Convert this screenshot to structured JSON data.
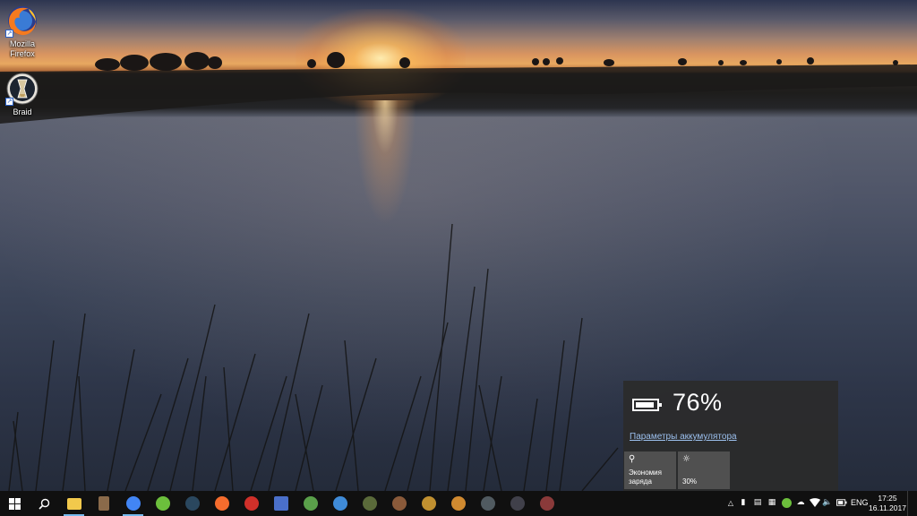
{
  "desktop": {
    "icons": [
      {
        "label_line1": "Mozilla",
        "label_line2": "Firefox",
        "icon": "firefox-icon"
      },
      {
        "label_line1": "Braid",
        "label_line2": "",
        "icon": "braid-icon"
      }
    ]
  },
  "battery_flyout": {
    "percent": "76%",
    "charge_level": 0.76,
    "settings_link": "Параметры аккумулятора",
    "tiles": [
      {
        "icon": "leaf-icon",
        "label_line1": "Экономия",
        "label_line2": "заряда"
      },
      {
        "icon": "brightness-icon",
        "label_line1": "30%",
        "label_line2": ""
      }
    ]
  },
  "taskbar": {
    "start_icon": "windows-logo-icon",
    "search_icon": "search-icon",
    "apps": [
      {
        "name": "file-explorer",
        "color": "#f2c94c",
        "active": true
      },
      {
        "name": "archive-app",
        "color": "#8a6a4a",
        "active": false
      },
      {
        "name": "chrome",
        "color": "#4285f4",
        "active": true
      },
      {
        "name": "utorrent",
        "color": "#6cbf3c",
        "active": false
      },
      {
        "name": "steam",
        "color": "#2a475e",
        "active": false
      },
      {
        "name": "origin",
        "color": "#f56c2d",
        "active": false
      },
      {
        "name": "pokerstars",
        "color": "#d0302a",
        "active": false
      },
      {
        "name": "save-app",
        "color": "#4a6fc9",
        "active": false
      },
      {
        "name": "green-app",
        "color": "#5aa04a",
        "active": false
      },
      {
        "name": "vivaldi",
        "color": "#3f8bd8",
        "active": false
      },
      {
        "name": "game-1",
        "color": "#5a6a3a",
        "active": false
      },
      {
        "name": "game-2",
        "color": "#8a5a3a",
        "active": false
      },
      {
        "name": "game-3",
        "color": "#c09030",
        "active": false
      },
      {
        "name": "game-4",
        "color": "#d08a30",
        "active": false
      },
      {
        "name": "game-5",
        "color": "#505a60",
        "active": false
      },
      {
        "name": "game-6",
        "color": "#40404a",
        "active": false
      },
      {
        "name": "game-7",
        "color": "#8a3a3a",
        "active": false
      }
    ],
    "tray": {
      "language": "ENG",
      "time": "17:25",
      "date": "16.11.2017"
    },
    "colors": {
      "background": "#101010",
      "active_indicator": "#76b9ed"
    }
  }
}
